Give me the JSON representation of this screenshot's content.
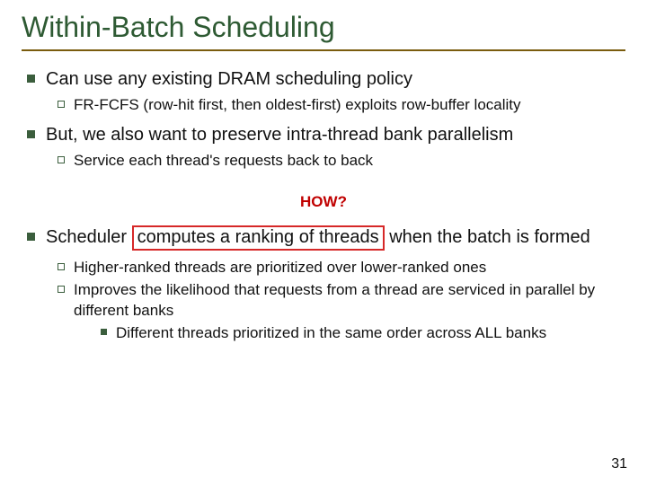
{
  "title": "Within-Batch Scheduling",
  "items": {
    "p1": "Can use any existing DRAM scheduling policy",
    "p1_1": "FR-FCFS (row-hit first, then oldest-first) exploits row-buffer locality",
    "p2": "But, we also want to preserve intra-thread bank parallelism",
    "p2_1": "Service each thread's requests back to back",
    "how": "HOW?",
    "p3_pre": "Scheduler ",
    "p3_box": "computes a ranking of threads",
    "p3_post": " when the batch is formed",
    "p3_1": "Higher-ranked threads are prioritized over lower-ranked ones",
    "p3_2": "Improves the likelihood that requests from a thread are serviced in parallel by different banks",
    "p3_2_1": "Different threads prioritized in the same order across ALL banks"
  },
  "page_number": "31"
}
